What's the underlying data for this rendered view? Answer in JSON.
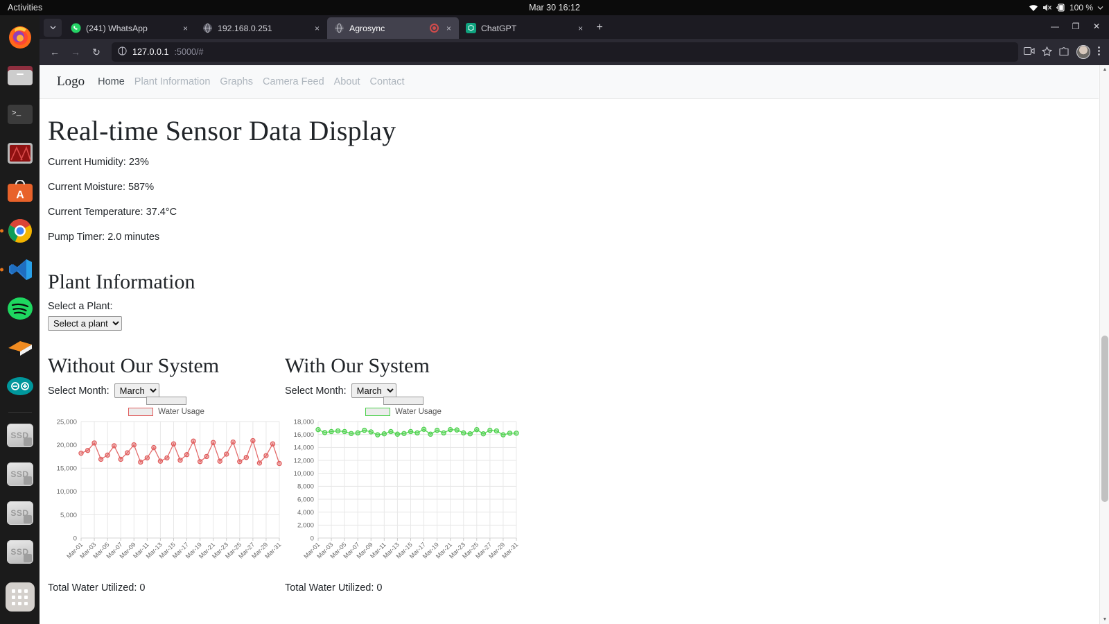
{
  "os": {
    "activities": "Activities",
    "clock": "Mar 30  16:12",
    "battery": "100 %",
    "dock_items": [
      {
        "name": "firefox",
        "running": false
      },
      {
        "name": "files",
        "running": false
      },
      {
        "name": "terminal",
        "running": false
      },
      {
        "name": "red-app",
        "running": false
      },
      {
        "name": "ubuntu-software",
        "running": false
      },
      {
        "name": "chrome",
        "running": true
      },
      {
        "name": "vscode",
        "running": true
      },
      {
        "name": "spotify",
        "running": false
      },
      {
        "name": "prusa-slicer",
        "running": false
      },
      {
        "name": "arduino-ide",
        "running": false
      }
    ],
    "drives": [
      "SSD",
      "SSD",
      "SSD",
      "SSD"
    ]
  },
  "browser": {
    "tabs": [
      {
        "title": "(241) WhatsApp",
        "favicon": "whatsapp-icon",
        "active": false,
        "recording": false
      },
      {
        "title": "192.168.0.251",
        "favicon": "globe-icon",
        "active": false,
        "recording": false
      },
      {
        "title": "Agrosync",
        "favicon": "globe-icon",
        "active": true,
        "recording": true
      },
      {
        "title": "ChatGPT",
        "favicon": "chatgpt-icon",
        "active": false,
        "recording": false
      }
    ],
    "url_host": "127.0.0.1",
    "url_path": ":5000/#",
    "new_tab_label": "+",
    "close_label": "×",
    "back_label": "←",
    "forward_label": "→",
    "reload_label": "↻",
    "minimize_label": "—",
    "maximize_label": "❐",
    "window_close_label": "✕"
  },
  "site": {
    "logo": "Logo",
    "nav": [
      {
        "label": "Home",
        "active": true
      },
      {
        "label": "Plant Information",
        "active": false
      },
      {
        "label": "Graphs",
        "active": false
      },
      {
        "label": "Camera Feed",
        "active": false
      },
      {
        "label": "About",
        "active": false
      },
      {
        "label": "Contact",
        "active": false
      }
    ]
  },
  "sensors": {
    "title": "Real-time Sensor Data Display",
    "humidity": "Current Humidity: 23%",
    "moisture": "Current Moisture: 587%",
    "temperature": "Current Temperature: 37.4°C",
    "pump": "Pump Timer: 2.0 minutes"
  },
  "plant_info": {
    "title": "Plant Information",
    "select_label": "Select a Plant:",
    "select_value": "Select a plant",
    "options": [
      "Select a plant"
    ]
  },
  "comparison": {
    "left": {
      "title": "Without Our System",
      "month_label": "Select Month:",
      "month_value": "March",
      "total": "Total Water Utilized: 0"
    },
    "right": {
      "title": "With Our System",
      "month_label": "Select Month:",
      "month_value": "March",
      "total": "Total Water Utilized: 0"
    },
    "month_options": [
      "March"
    ]
  },
  "chart_data": [
    {
      "type": "line",
      "id": "without-our-system",
      "title": "",
      "legend": [
        "Water Usage"
      ],
      "legend_position": "top-center",
      "color": "#e05c5c",
      "xlabel": "",
      "ylabel": "",
      "ylim": [
        0,
        25000
      ],
      "yticks": [
        0,
        5000,
        10000,
        15000,
        20000,
        25000
      ],
      "ytick_labels": [
        "0",
        "5,000",
        "10,000",
        "15,000",
        "20,000",
        "25,000"
      ],
      "grid": true,
      "categories": [
        "Mar-01",
        "Mar-02",
        "Mar-03",
        "Mar-04",
        "Mar-05",
        "Mar-06",
        "Mar-07",
        "Mar-08",
        "Mar-09",
        "Mar-10",
        "Mar-11",
        "Mar-12",
        "Mar-13",
        "Mar-14",
        "Mar-15",
        "Mar-16",
        "Mar-17",
        "Mar-18",
        "Mar-19",
        "Mar-20",
        "Mar-21",
        "Mar-22",
        "Mar-23",
        "Mar-24",
        "Mar-25",
        "Mar-26",
        "Mar-27",
        "Mar-28",
        "Mar-29",
        "Mar-30",
        "Mar-31"
      ],
      "xtick_labels": [
        "Mar-01",
        "Mar-03",
        "Mar-05",
        "Mar-07",
        "Mar-09",
        "Mar-11",
        "Mar-13",
        "Mar-15",
        "Mar-17",
        "Mar-19",
        "Mar-21",
        "Mar-23",
        "Mar-25",
        "Mar-27",
        "Mar-29",
        "Mar-31"
      ],
      "values": [
        18200,
        18800,
        20400,
        16900,
        17800,
        19800,
        16900,
        18300,
        20000,
        16300,
        17200,
        19400,
        16500,
        17200,
        20200,
        16700,
        17900,
        20800,
        16400,
        17500,
        20500,
        16500,
        18000,
        20600,
        16400,
        17300,
        20900,
        16100,
        17700,
        20200,
        16000
      ]
    },
    {
      "type": "line",
      "id": "with-our-system",
      "title": "",
      "legend": [
        "Water Usage"
      ],
      "legend_position": "top-center",
      "color": "#4ad14a",
      "xlabel": "",
      "ylabel": "",
      "ylim": [
        0,
        18000
      ],
      "yticks": [
        0,
        2000,
        4000,
        6000,
        8000,
        10000,
        12000,
        14000,
        16000,
        18000
      ],
      "ytick_labels": [
        "0",
        "2,000",
        "4,000",
        "6,000",
        "8,000",
        "10,000",
        "12,000",
        "14,000",
        "16,000",
        "18,000"
      ],
      "grid": true,
      "categories": [
        "Mar-01",
        "Mar-02",
        "Mar-03",
        "Mar-04",
        "Mar-05",
        "Mar-06",
        "Mar-07",
        "Mar-08",
        "Mar-09",
        "Mar-10",
        "Mar-11",
        "Mar-12",
        "Mar-13",
        "Mar-14",
        "Mar-15",
        "Mar-16",
        "Mar-17",
        "Mar-18",
        "Mar-19",
        "Mar-20",
        "Mar-21",
        "Mar-22",
        "Mar-23",
        "Mar-24",
        "Mar-25",
        "Mar-26",
        "Mar-27",
        "Mar-28",
        "Mar-29",
        "Mar-30",
        "Mar-31"
      ],
      "xtick_labels": [
        "Mar-01",
        "Mar-03",
        "Mar-05",
        "Mar-07",
        "Mar-09",
        "Mar-11",
        "Mar-13",
        "Mar-15",
        "Mar-17",
        "Mar-19",
        "Mar-21",
        "Mar-23",
        "Mar-25",
        "Mar-27",
        "Mar-29",
        "Mar-31"
      ],
      "values": [
        16750,
        16300,
        16450,
        16550,
        16450,
        16150,
        16250,
        16650,
        16400,
        15950,
        16100,
        16450,
        16050,
        16150,
        16450,
        16250,
        16800,
        16050,
        16650,
        16250,
        16750,
        16700,
        16250,
        16100,
        16750,
        16100,
        16650,
        16550,
        15950,
        16200,
        16200
      ]
    }
  ]
}
